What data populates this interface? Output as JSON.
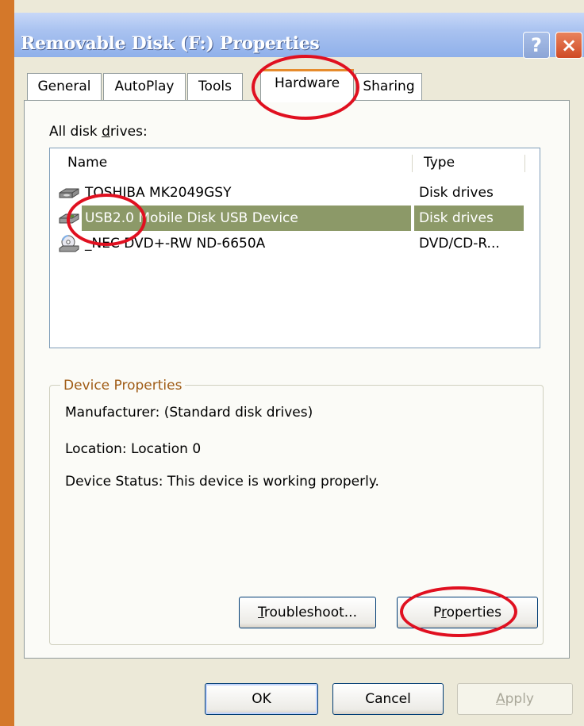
{
  "window": {
    "title": "Removable Disk (F:) Properties",
    "help_label": "?",
    "close_label": "×"
  },
  "tabs": [
    {
      "label": "General"
    },
    {
      "label": "AutoPlay"
    },
    {
      "label": "Tools"
    },
    {
      "label": "Hardware",
      "active": true
    },
    {
      "label": "Sharing"
    }
  ],
  "drives": {
    "label_prefix": "All disk ",
    "label_accel": "d",
    "label_suffix": "rives:",
    "columns": {
      "name": "Name",
      "type": "Type"
    },
    "rows": [
      {
        "icon": "hard-disk-icon",
        "name": "TOSHIBA MK2049GSY",
        "type": "Disk drives",
        "selected": false
      },
      {
        "icon": "removable-disk-icon",
        "name": "USB2.0 Mobile Disk USB Device",
        "type": "Disk drives",
        "selected": true
      },
      {
        "icon": "dvd-drive-icon",
        "name": "_NEC DVD+-RW ND-6650A",
        "type": "DVD/CD-R...",
        "selected": false
      }
    ]
  },
  "device_properties": {
    "title": "Device Properties",
    "manufacturer": "Manufacturer: (Standard disk drives)",
    "location": "Location: Location 0",
    "status": "Device Status: This device is working properly."
  },
  "buttons": {
    "troubleshoot_accel": "T",
    "troubleshoot_rest": "roubleshoot...",
    "properties_prefix": "P",
    "properties_accel": "r",
    "properties_suffix": "operties",
    "ok": "OK",
    "cancel": "Cancel",
    "apply_accel": "A",
    "apply_rest": "pply"
  },
  "colors": {
    "selection": "#8c9968",
    "tab_highlight": "#e68b2c",
    "annotation_circle": "#e01020",
    "frame": "#d4782a"
  }
}
